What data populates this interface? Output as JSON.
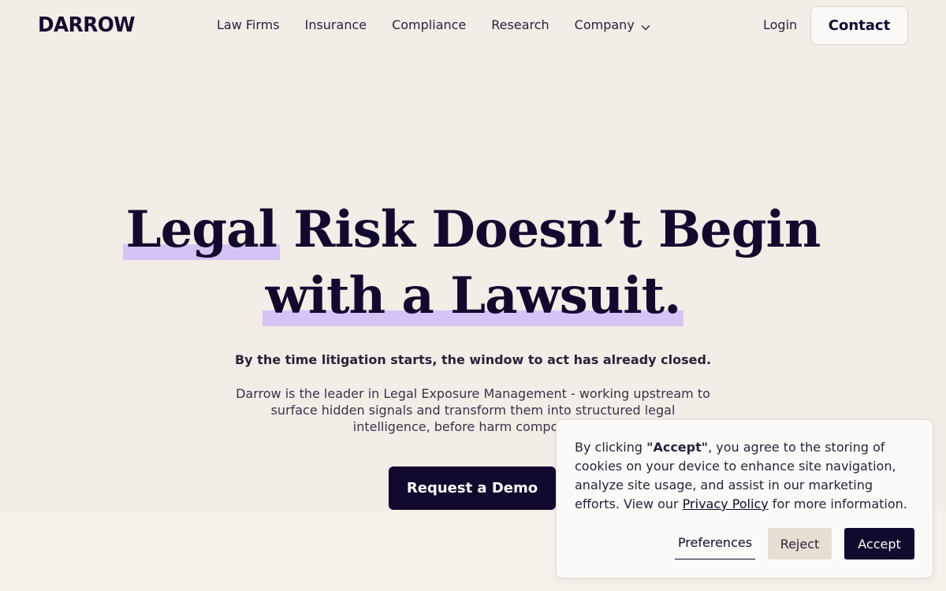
{
  "header": {
    "logo": "DARROW",
    "nav": [
      {
        "label": "Law Firms"
      },
      {
        "label": "Insurance"
      },
      {
        "label": "Compliance"
      },
      {
        "label": "Research"
      },
      {
        "label": "Company",
        "has_dropdown": true,
        "icon": "chevron-down-icon"
      }
    ],
    "login_label": "Login",
    "contact_label": "Contact"
  },
  "hero": {
    "title_line1_highlight": "Legal",
    "title_line1_rest": " Risk Doesn’t Begin",
    "title_line2_highlight": "with a Lawsuit.",
    "subheading": "By the time litigation starts, the window to act has already closed.",
    "description": "Darrow is the leader in Legal Exposure Management - working upstream to surface hidden signals and transform them into structured legal intelligence, before harm compounds.",
    "cta_label": "Request a Demo"
  },
  "cookie_banner": {
    "text_prefix": "By clicking ",
    "accept_quoted": "\"Accept\"",
    "text_middle": ", you agree to the storing of cookies on your device to enhance site navigation, analyze site usage, and assist in our marketing efforts. View our ",
    "privacy_link": "Privacy Policy",
    "text_suffix": " for more information.",
    "preferences_label": "Preferences",
    "reject_label": "Reject",
    "accept_label": "Accept"
  },
  "colors": {
    "background": "#f2ede7",
    "primary_dark": "#120a2e",
    "highlight": "#d6c3f5",
    "reject_bg": "#e6ded3"
  }
}
